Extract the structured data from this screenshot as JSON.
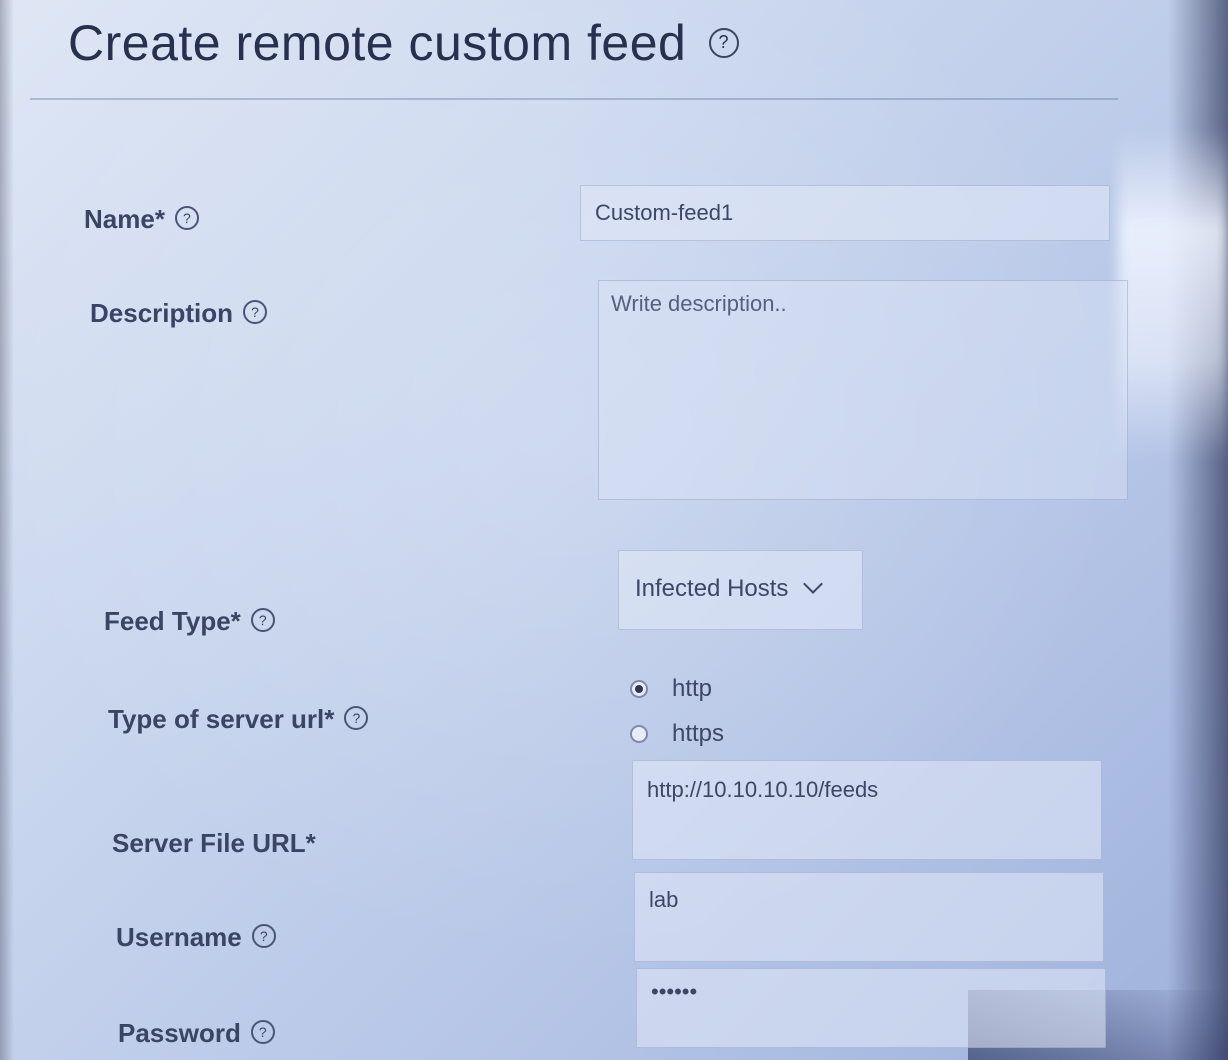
{
  "page": {
    "title": "Create remote custom feed",
    "help_glyph": "?"
  },
  "form": {
    "name": {
      "label": "Name*",
      "value": "Custom-feed1"
    },
    "description": {
      "label": "Description",
      "placeholder": "Write description..",
      "value": ""
    },
    "feed_type": {
      "label": "Feed Type*",
      "selected": "Infected Hosts",
      "icon": "chevron-down-icon"
    },
    "server_url_type": {
      "label": "Type of server url*",
      "options": [
        "http",
        "https"
      ],
      "selected": "http"
    },
    "server_file_url": {
      "label": "Server File URL*",
      "value": "http://10.10.10.10/feeds"
    },
    "username": {
      "label": "Username",
      "value": "lab"
    },
    "password": {
      "label": "Password",
      "value": "••••••"
    }
  }
}
